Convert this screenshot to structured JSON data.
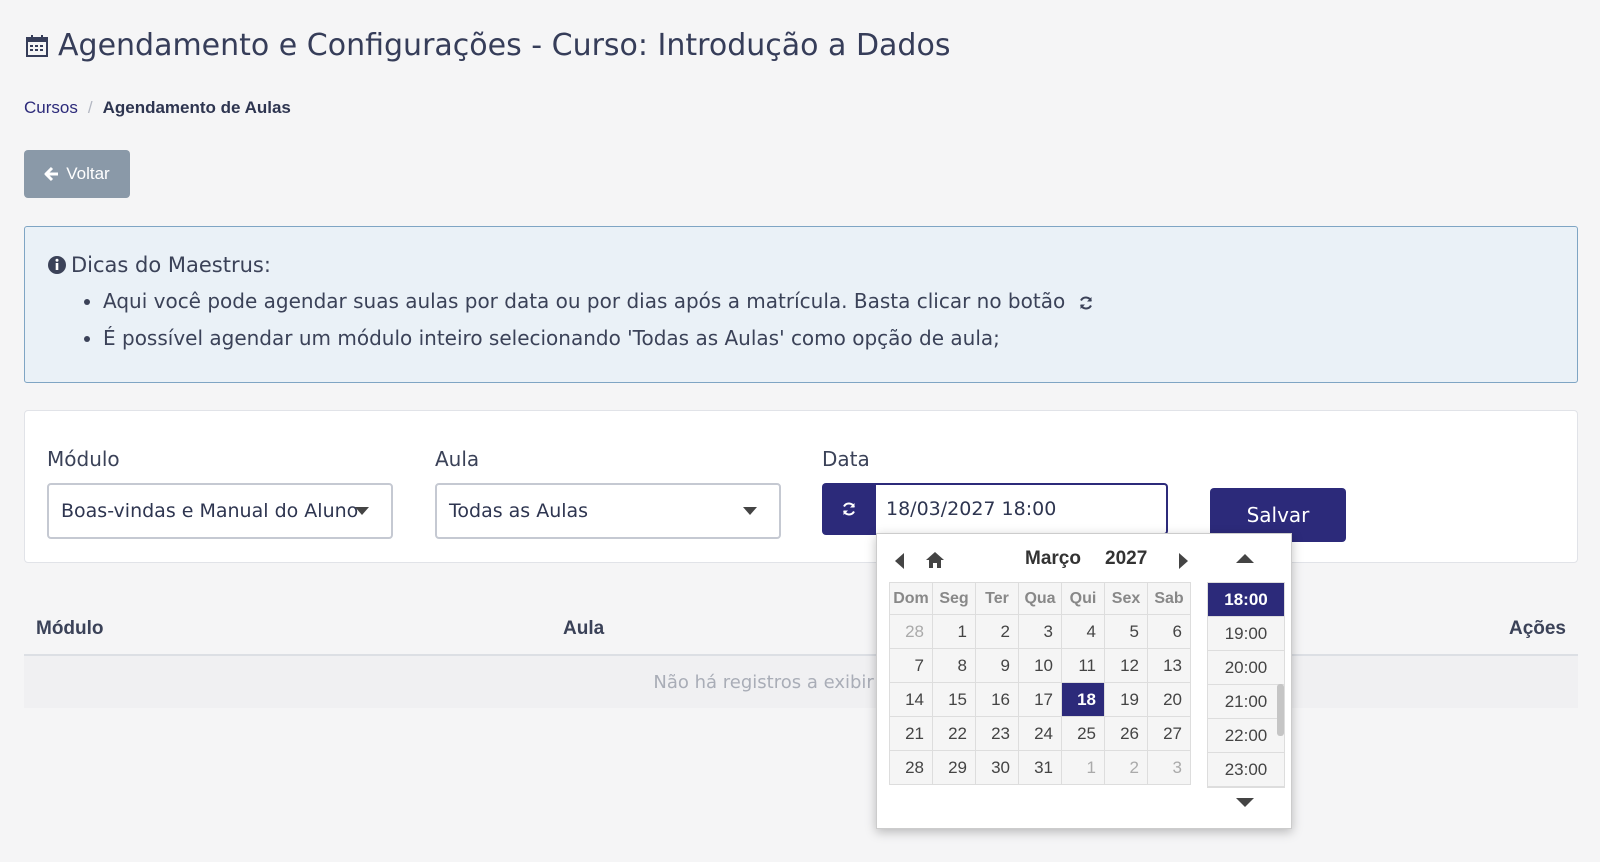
{
  "page": {
    "title": "Agendamento e Configurações - Curso: Introdução a Dados"
  },
  "breadcrumb": {
    "items": [
      {
        "label": "Cursos"
      },
      {
        "label": "Agendamento de Aulas"
      }
    ],
    "separator": "/"
  },
  "back_button": {
    "label": "Voltar"
  },
  "tips": {
    "title": "Dicas do Maestrus:",
    "items": [
      "Aqui você pode agendar suas aulas por data ou por dias após a matrícula. Basta clicar no botão",
      "É possível agendar um módulo inteiro selecionando 'Todas as Aulas' como opção de aula;"
    ]
  },
  "form": {
    "module_label": "Módulo",
    "module_value": "Boas-vindas e Manual do Aluno",
    "lesson_label": "Aula",
    "lesson_value": "Todas as Aulas",
    "date_label": "Data",
    "date_value": "18/03/2027 18:00",
    "save_label": "Salvar"
  },
  "table": {
    "columns": [
      "Módulo",
      "Aula",
      "Ações"
    ],
    "empty_message": "Não há registros a exibir para ag"
  },
  "datepicker": {
    "month": "Março",
    "year": "2027",
    "weekdays": [
      "Dom",
      "Seg",
      "Ter",
      "Qua",
      "Qui",
      "Sex",
      "Sab"
    ],
    "weeks": [
      [
        {
          "d": "28",
          "other": true
        },
        {
          "d": "1"
        },
        {
          "d": "2"
        },
        {
          "d": "3"
        },
        {
          "d": "4"
        },
        {
          "d": "5"
        },
        {
          "d": "6"
        }
      ],
      [
        {
          "d": "7"
        },
        {
          "d": "8"
        },
        {
          "d": "9"
        },
        {
          "d": "10"
        },
        {
          "d": "11"
        },
        {
          "d": "12"
        },
        {
          "d": "13"
        }
      ],
      [
        {
          "d": "14"
        },
        {
          "d": "15"
        },
        {
          "d": "16"
        },
        {
          "d": "17"
        },
        {
          "d": "18",
          "selected": true
        },
        {
          "d": "19"
        },
        {
          "d": "20"
        }
      ],
      [
        {
          "d": "21"
        },
        {
          "d": "22"
        },
        {
          "d": "23"
        },
        {
          "d": "24"
        },
        {
          "d": "25"
        },
        {
          "d": "26"
        },
        {
          "d": "27"
        }
      ],
      [
        {
          "d": "28"
        },
        {
          "d": "29"
        },
        {
          "d": "30"
        },
        {
          "d": "31"
        },
        {
          "d": "1",
          "other": true
        },
        {
          "d": "2",
          "other": true
        },
        {
          "d": "3",
          "other": true
        }
      ]
    ],
    "times": [
      "18:00",
      "19:00",
      "20:00",
      "21:00",
      "22:00",
      "23:00"
    ],
    "selected_time": "18:00"
  },
  "colors": {
    "primary": "#2c2a7a",
    "back_button": "#8a99a8",
    "tips_bg": "#eaf1f7",
    "tips_border": "#7fa5c4"
  }
}
